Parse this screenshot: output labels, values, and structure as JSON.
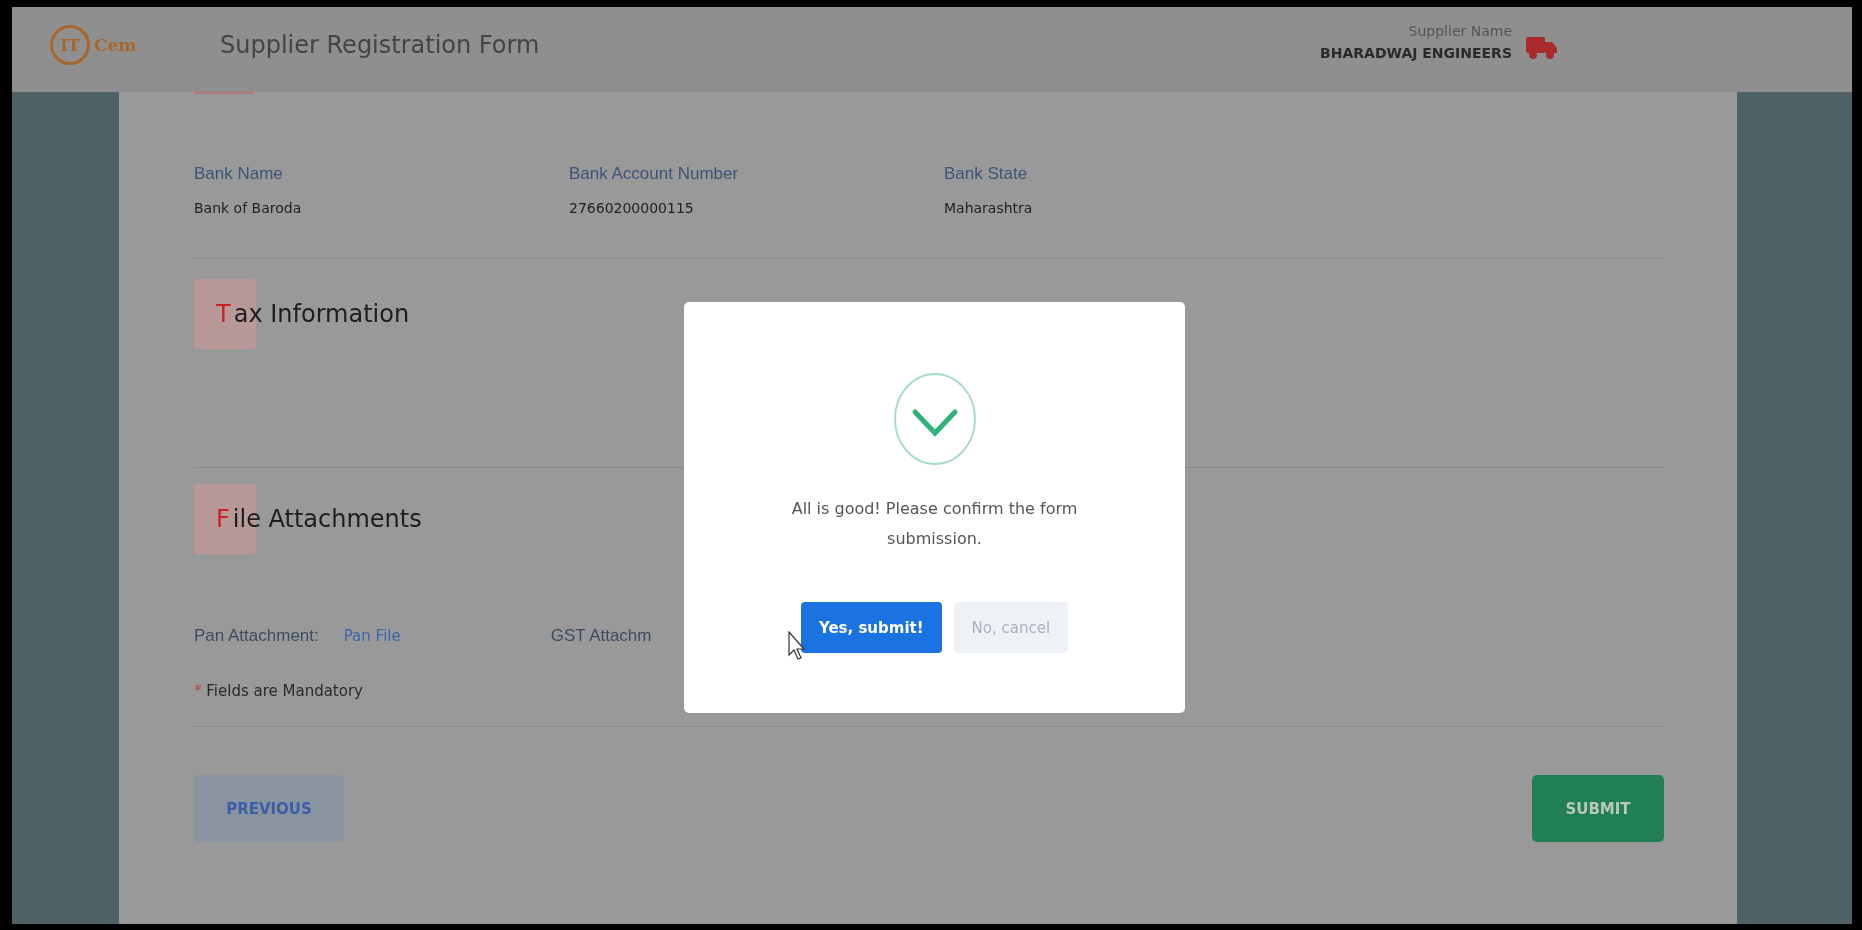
{
  "header": {
    "logo": {
      "mark": "IT",
      "name": "Cem"
    },
    "title": "Supplier Registration Form",
    "supplier_label": "Supplier Name",
    "supplier_name": "BHARADWAJ ENGINEERS"
  },
  "bank": [
    {
      "label": "Bank Name",
      "value": "Bank of Baroda"
    },
    {
      "label": "Bank Account Number",
      "value": "27660200000115"
    },
    {
      "label": "Bank State",
      "value": "Maharashtra"
    }
  ],
  "sections": [
    {
      "title": "Tax Information"
    },
    {
      "title": "File Attachments"
    }
  ],
  "attachments": [
    {
      "label": "Pan Attachment:",
      "link": "Pan File"
    },
    {
      "label": "GST Attachm"
    }
  ],
  "mandatory_note": {
    "mark": "*",
    "text": "Fields are Mandatory"
  },
  "buttons": {
    "previous": "PREVIOUS",
    "submit": "SUBMIT"
  },
  "dialog": {
    "message": "All is good! Please confirm the form submission.",
    "confirm": "Yes, submit!",
    "cancel": "No, cancel"
  }
}
